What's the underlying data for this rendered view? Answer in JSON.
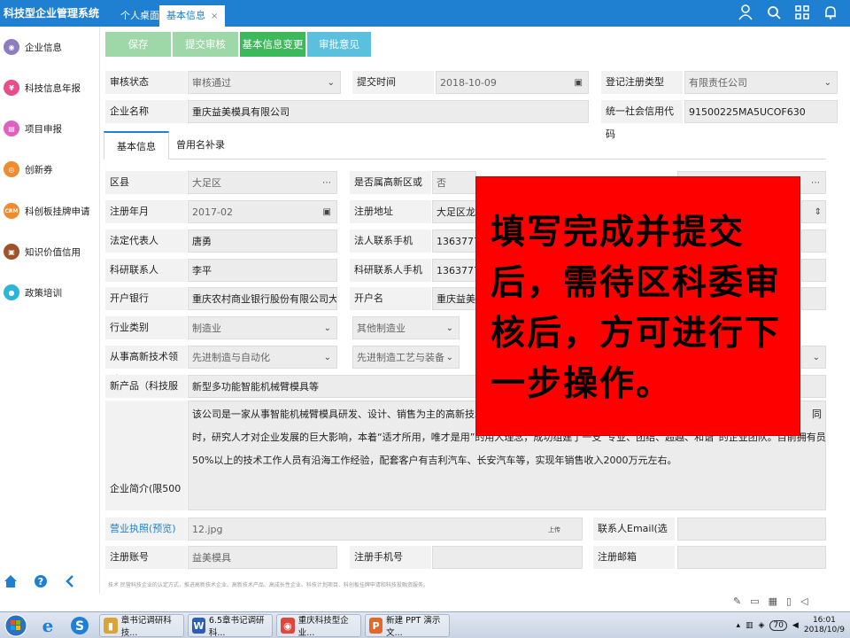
{
  "app": {
    "title": "科技型企业管理系统"
  },
  "tabs": [
    {
      "label": "个人桌面"
    },
    {
      "label": "基本信息",
      "close": "×"
    }
  ],
  "top_icons": [
    "user-icon",
    "search-icon",
    "grid-icon",
    "bell-icon"
  ],
  "sidebar": {
    "items": [
      {
        "label": "企业信息",
        "icon": "building-icon",
        "color": "#8e7cc3"
      },
      {
        "label": "科技信息年报",
        "icon": "report-icon",
        "color": "#e84c8b"
      },
      {
        "label": "项目申报",
        "icon": "project-icon",
        "color": "#e060c0"
      },
      {
        "label": "创新券",
        "icon": "coupon-icon",
        "color": "#f08c30"
      },
      {
        "label": "科创板挂牌申请",
        "icon": "crm-icon",
        "icon_text": "CRM",
        "color": "#f08c30"
      },
      {
        "label": "知识价值信用",
        "icon": "knowledge-icon",
        "color": "#a0522d"
      },
      {
        "label": "政策培训",
        "icon": "training-icon",
        "color": "#29b6d8"
      }
    ],
    "bottom": [
      "home-icon",
      "help-icon",
      "back-icon"
    ]
  },
  "actions": [
    {
      "label": "保存",
      "color": "#9ed8a8",
      "disabled": true
    },
    {
      "label": "提交审核",
      "color": "#9ed8a8",
      "disabled": true
    },
    {
      "label": "基本信息变更",
      "color": "#3cb95a",
      "disabled": false
    },
    {
      "label": "审批意见",
      "color": "#5bc0de",
      "disabled": false
    }
  ],
  "header_fields": {
    "audit_status_label": "审核状态",
    "audit_status_value": "审核通过",
    "submit_time_label": "提交时间",
    "submit_time_value": "2018-10-09",
    "reg_type_label": "登记注册类型",
    "reg_type_value": "有限责任公司",
    "company_name_label": "企业名称",
    "company_name_value": "重庆益美模具有限公司",
    "credit_code_label": "统一社会信用代码",
    "credit_code_value": "91500225MA5UCOF630"
  },
  "section_tabs": [
    {
      "label": "基本信息"
    },
    {
      "label": "曾用名补录"
    }
  ],
  "form": {
    "district_label": "区县",
    "district_value": "大足区",
    "hightech_zone_label": "是否属高新区或两...",
    "hightech_zone_value": "否",
    "reg_year_label": "注册年月",
    "reg_year_value": "2017-02",
    "reg_address_label": "注册地址",
    "reg_address_value": "大足区龙水镇",
    "legal_rep_label": "法定代表人",
    "legal_rep_value": "唐勇",
    "legal_phone_label": "法人联系手机",
    "legal_phone_value": "13637775",
    "rd_contact_label": "科研联系人",
    "rd_contact_value": "李平",
    "rd_phone_label": "科研联系人手机",
    "rd_phone_value": "13637775",
    "bank_label": "开户银行",
    "bank_value": "重庆农村商业银行股份有限公司大足龙",
    "account_name_label": "开户名",
    "account_name_value": "重庆益美模",
    "industry_label": "行业类别",
    "industry_value": "制造业",
    "industry_sub_value": "其他制造业",
    "tech_field_label": "从事高新技术领域",
    "tech_field_value": "先进制造与自动化",
    "tech_field_sub_value": "先进制造工艺与装备",
    "new_product_label": "新产品（科技服务...",
    "new_product_value": "新型多功能智能机械臂模具等",
    "intro_label": "企业简介(限500字)",
    "intro_line1": "该公司是一家从事智能机械臂模具研发、设计、销售为主的高新技术企业，",
    "intro_line1_tail": "同",
    "intro_line2": "时，研究人才对企业发展的巨大影响，本着“适才所用，唯才是用”的用人理念，成功组建了一支“专业、团结、超越、和谐”的企业团队。目前拥有员工37人，其中",
    "intro_line3": "50%以上的技术工作人员有沿海工作经验，配套客户有吉利汽车、长安汽车等，实现年销售收入2000万元左右。",
    "license_label": "营业执照(预览)",
    "license_value": "12.jpg",
    "license_upload": "上传",
    "contact_email_label": "联系人Email(选填)",
    "contact_email_value": "",
    "reg_account_label": "注册账号",
    "reg_account_value": "益美模具",
    "reg_phone_label": "注册手机号",
    "reg_phone_value": "",
    "reg_email_label": "注册邮箱",
    "reg_email_value": ""
  },
  "footer_note": "技术 民营科技企业的认定方式，推进高新技术企业、高新技术产品、高成长性企业、科技计划项目、科创板挂牌申请和科技投融资服务。",
  "overlay": {
    "text": "填写完成并提交后，需待区科委审核后，方可进行下一步操作。",
    "color": "#ff0000"
  },
  "taskbar": {
    "items": [
      {
        "label": "章书记调研科技...",
        "icon_text": "▮",
        "color": "#d9a43a"
      },
      {
        "label": "6.5章书记调研科...",
        "icon_text": "W",
        "color": "#2b5fb6"
      },
      {
        "label": "重庆科技型企业...",
        "icon_text": "◉",
        "color": "#e0463c"
      },
      {
        "label": "新建 PPT 演示文...",
        "icon_text": "P",
        "color": "#e3662b"
      }
    ],
    "time": "16:01",
    "date": "2018/10/9",
    "battery": "70"
  }
}
